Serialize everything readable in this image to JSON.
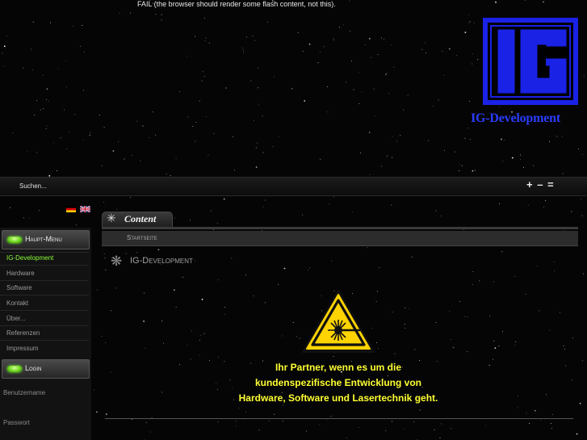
{
  "flash": {
    "fail_text": "FAIL (the browser should render some flash content, not this)."
  },
  "logo": {
    "letters": "IG",
    "text": "IG-Development",
    "color": "#1a22e6"
  },
  "search": {
    "placeholder": "Suchen..."
  },
  "font_tools": {
    "label": "+ – ="
  },
  "languages": [
    {
      "icon": "german-flag-icon"
    },
    {
      "icon": "uk-flag-icon"
    }
  ],
  "main_menu": {
    "title": "Haupt-Menu",
    "items": [
      {
        "label": "IG-Development",
        "active": true
      },
      {
        "label": "Hardware"
      },
      {
        "label": "Software"
      },
      {
        "label": "Kontakt"
      },
      {
        "label": "Über..."
      },
      {
        "label": "Referenzen"
      },
      {
        "label": "Impressum"
      }
    ]
  },
  "login": {
    "title": "Login",
    "username_label": "Benutzername",
    "password_label": "Passwort"
  },
  "content": {
    "tab_label": "Content",
    "breadcrumb": "Startseite",
    "title": "IG-Development",
    "slogan": [
      "Ihr Partner, wenn es um die",
      "kundenspezifische Entwicklung von",
      "Hardware, Software und Lasertechnik geht."
    ],
    "warning_icon": "laser-warning-icon"
  },
  "colors": {
    "accent_green": "#8bff3a",
    "slogan_yellow": "#ffff33",
    "logo_blue": "#1a22e6"
  }
}
